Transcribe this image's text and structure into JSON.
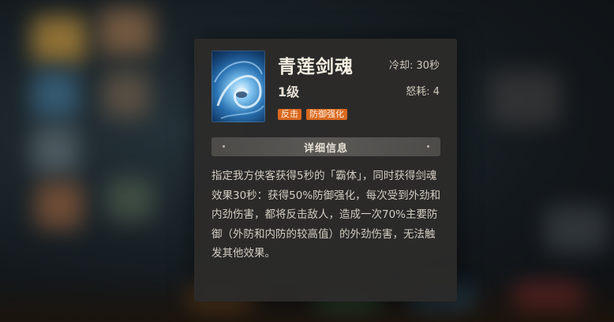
{
  "skill": {
    "name": "青莲剑魂",
    "level": "1级",
    "cooldown": "冷却: 30秒",
    "rage": "怒耗: 4",
    "tags": [
      "反击",
      "防御强化"
    ],
    "icon": "sword-soul-swirl-icon"
  },
  "detail": {
    "header": "详细信息",
    "description": "指定我方侠客获得5秒的「霸体」，同时获得剑魂效果30秒：获得50%防御强化，每次受到外劲和内劲伤害，都将反击敌人，造成一次70%主要防御（外防和内防的较高值）的外劲伤害，无法触发其他效果。"
  },
  "colors": {
    "panel_bg": "#2c2b2a",
    "tag_orange": "#d9691f",
    "text_primary": "#f4eee2",
    "text_secondary": "#d3cdc2"
  }
}
